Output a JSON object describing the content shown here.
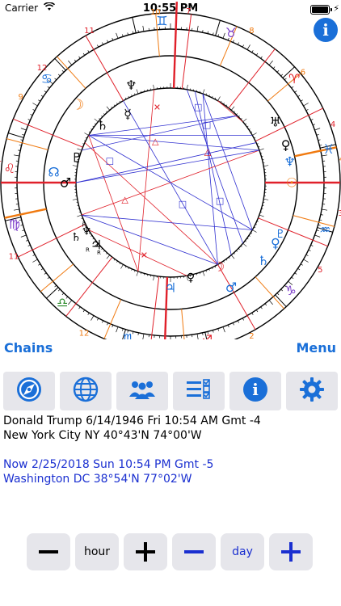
{
  "status_bar": {
    "carrier": "Carrier",
    "time": "10:55 PM"
  },
  "nav": {
    "chains_label": "Chains",
    "menu_label": "Menu"
  },
  "chart": {
    "house_numbers": [
      "10",
      "7",
      "8",
      "11",
      "9",
      "12",
      "6",
      "1",
      "5",
      "11",
      "12",
      "3",
      "2",
      "4",
      "4",
      "1"
    ],
    "retrograde_markers": [
      "R",
      "R",
      "R"
    ]
  },
  "toolbar": {
    "icons": [
      "compass-icon",
      "globe-icon",
      "people-icon",
      "checklist-icon",
      "info-icon",
      "gear-icon"
    ]
  },
  "natal": {
    "line1": "Donald Trump 6/14/1946 Fri 10:54 AM Gmt -4",
    "line2": "New York City NY 40°43'N 74°00'W"
  },
  "transit": {
    "line1": "Now 2/25/2018 Sun 10:54 PM Gmt -5",
    "line2": "Washington DC 38°54'N 77°02'W"
  },
  "steppers": {
    "hour_label": "hour",
    "day_label": "day",
    "minus": "−",
    "plus": "+"
  },
  "colors": {
    "accent": "#1a6fd8",
    "transit_text": "#1a2fd0",
    "aspect_red": "#e0202a",
    "aspect_blue": "#3030d0"
  }
}
